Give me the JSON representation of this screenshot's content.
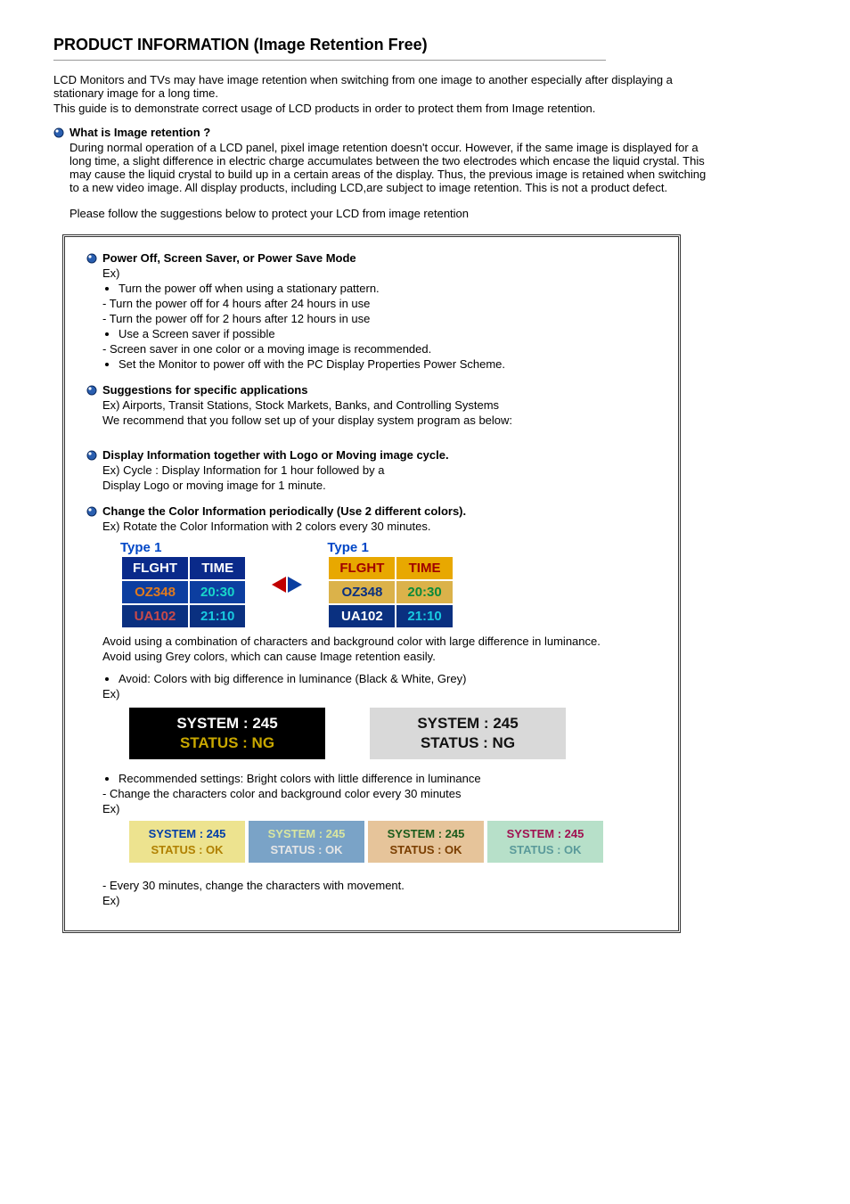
{
  "title": "PRODUCT INFORMATION (Image Retention Free)",
  "intro": {
    "p1": "LCD Monitors and TVs may have image retention when switching from one image to another especially after displaying a stationary image for a long time.",
    "p2": "This guide is to demonstrate correct usage of LCD products in order to protect them from Image retention."
  },
  "s1": {
    "title": "What is Image retention ?",
    "body": "During normal operation of a LCD panel, pixel image retention doesn't occur. However, if the same image is displayed for a long time, a slight difference in electric charge accumulates between the two electrodes which encase the liquid crystal. This may cause the liquid crystal to build up in a certain areas of the display. Thus, the previous image is retained when switching to a new video image. All display products, including LCD,are subject to image retention. This is not a product defect.",
    "follow": "Please follow the suggestions below to protect your LCD from image retention"
  },
  "box": {
    "a": {
      "title": "Power Off, Screen Saver, or Power Save Mode",
      "ex": "Ex)",
      "b1": "Turn the power off when using a stationary pattern.",
      "b1a": "- Turn the power off for 4 hours after 24 hours in use",
      "b1b": "- Turn the power off for 2 hours after 12 hours in use",
      "b2": "Use a Screen saver if possible",
      "b2a": "- Screen saver in one color or a moving image is recommended.",
      "b3": "Set the Monitor to power off with the PC Display Properties Power Scheme."
    },
    "b": {
      "title": "Suggestions for specific applications",
      "l1": "Ex) Airports, Transit Stations, Stock Markets, Banks, and Controlling Systems",
      "l2": "We recommend that you follow set up of your display system program as below:"
    },
    "c": {
      "title": "Display Information together with Logo or Moving image cycle.",
      "l1": "Ex) Cycle : Display Information for 1 hour followed by a",
      "l2": "Display Logo or moving image for 1 minute."
    },
    "d": {
      "title": "Change the Color Information periodically (Use 2 different colors).",
      "l1": "Ex) Rotate the Color Information with 2 colors every 30 minutes."
    },
    "flight": {
      "type": "Type 1",
      "h1": "FLGHT",
      "h2": "TIME",
      "r1c1": "OZ348",
      "r1c2": "20:30",
      "r2c1": "UA102",
      "r2c2": "21:10"
    },
    "avoid": {
      "l1": "Avoid using a combination of characters and background color with large difference in luminance.",
      "l2": "Avoid using Grey colors, which can cause Image retention easily.",
      "b1": "Avoid: Colors with big difference in luminance (Black & White, Grey)",
      "ex1": "Ex)"
    },
    "sys": {
      "l1": "SYSTEM : 245",
      "l2ng": "STATUS : NG",
      "l2ok": "STATUS : OK"
    },
    "rec": {
      "b1": "Recommended settings: Bright colors with little difference in luminance",
      "l1": "- Change the characters color and background color every 30 minutes",
      "ex2": "Ex)",
      "l2": "- Every 30 minutes, change the characters with movement.",
      "ex3": "Ex)"
    }
  }
}
